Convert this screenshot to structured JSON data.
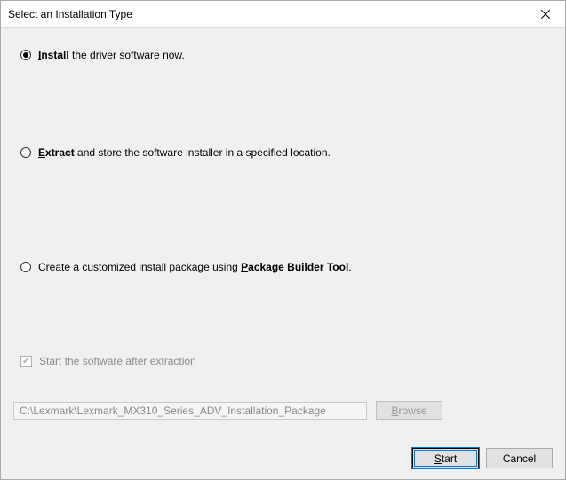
{
  "title": "Select an Installation Type",
  "options": {
    "install": {
      "bold": "Install",
      "rest": " the driver software now.",
      "boldUL": "I"
    },
    "extract": {
      "bold": "Extract",
      "rest": " and store the software installer in a specified location.",
      "boldUL": "E"
    },
    "package": {
      "pre": "Create a customized install package using ",
      "bold": "Package Builder Tool",
      "post": ".",
      "boldUL": "P"
    }
  },
  "checkbox": {
    "preUL": "Star",
    "ul": "t",
    "post": " the software after extraction"
  },
  "path": {
    "value": "C:\\Lexmark\\Lexmark_MX310_Series_ADV_Installation_Package"
  },
  "buttons": {
    "browse": {
      "ul": "B",
      "rest": "rowse"
    },
    "start": {
      "ul": "S",
      "rest": "tart"
    },
    "cancel": "Cancel"
  }
}
